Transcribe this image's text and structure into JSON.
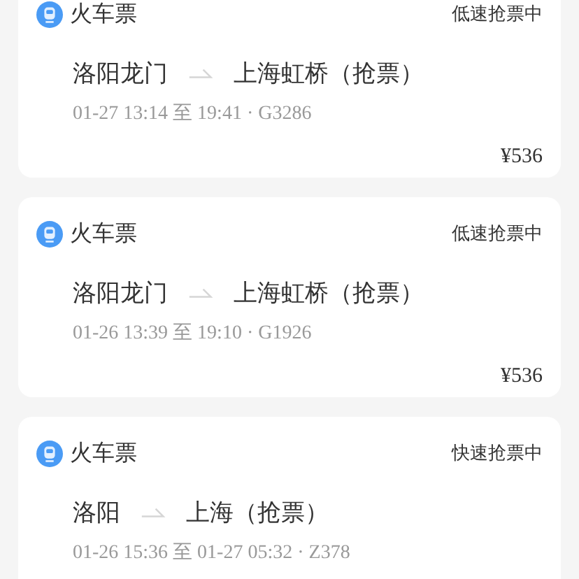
{
  "orders": [
    {
      "title": "火车票",
      "status": "低速抢票中",
      "from": "洛阳龙门",
      "to": "上海虹桥（抢票）",
      "detail": "01-27 13:14 至 19:41 · G3286",
      "price": "¥536"
    },
    {
      "title": "火车票",
      "status": "低速抢票中",
      "from": "洛阳龙门",
      "to": "上海虹桥（抢票）",
      "detail": "01-26 13:39 至 19:10 · G1926",
      "price": "¥536"
    },
    {
      "title": "火车票",
      "status": "快速抢票中",
      "from": "洛阳",
      "to": "上海（抢票）",
      "detail": "01-26 15:36 至 01-27 05:32 · Z378"
    }
  ]
}
